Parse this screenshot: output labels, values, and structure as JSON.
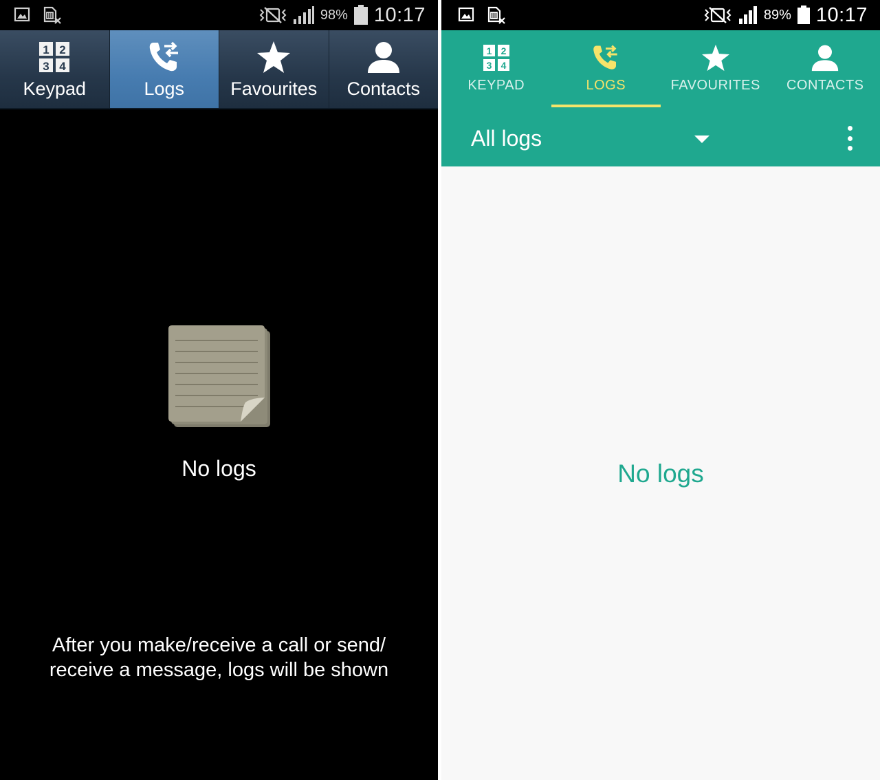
{
  "left_screen": {
    "status_bar": {
      "notification_icons": [
        "image-icon",
        "sim-card-missing-icon"
      ],
      "status_icons": [
        "vibrate-mode-icon",
        "signal-icon",
        "battery-icon"
      ],
      "battery_percent": "98%",
      "time": "10:17"
    },
    "tabs": [
      {
        "label": "Keypad",
        "icon": "keypad-icon",
        "active": false
      },
      {
        "label": "Logs",
        "icon": "call-logs-icon",
        "active": true
      },
      {
        "label": "Favourites",
        "icon": "star-icon",
        "active": false
      },
      {
        "label": "Contacts",
        "icon": "contact-icon",
        "active": false
      }
    ],
    "empty_state": {
      "icon": "notepad-icon",
      "title": "No logs",
      "hint_line1": "After you make/receive a call or send/",
      "hint_line2": "receive a message, logs will be shown"
    },
    "colors": {
      "tab_bar": "#2a3c50",
      "active_tab": "#4a7fb2",
      "background": "#000000"
    }
  },
  "right_screen": {
    "status_bar": {
      "notification_icons": [
        "image-icon",
        "sim-card-missing-icon"
      ],
      "status_icons": [
        "vibrate-mode-icon",
        "signal-icon",
        "battery-icon"
      ],
      "battery_percent": "89%",
      "time": "10:17"
    },
    "tabs": [
      {
        "label": "KEYPAD",
        "icon": "keypad-icon",
        "active": false
      },
      {
        "label": "LOGS",
        "icon": "call-logs-icon",
        "active": true
      },
      {
        "label": "FAVOURITES",
        "icon": "star-icon",
        "active": false
      },
      {
        "label": "CONTACTS",
        "icon": "contact-icon",
        "active": false
      }
    ],
    "filter": {
      "selected": "All logs",
      "icon": "dropdown-arrow-icon"
    },
    "menu_icon": "more-options-icon",
    "empty_state": {
      "title": "No logs"
    },
    "colors": {
      "header": "#1fa88f",
      "active_tab_label": "#f7e36a",
      "indicator": "#f3e46a",
      "empty_text": "#1fa88f",
      "background": "#f8f8f8"
    }
  }
}
